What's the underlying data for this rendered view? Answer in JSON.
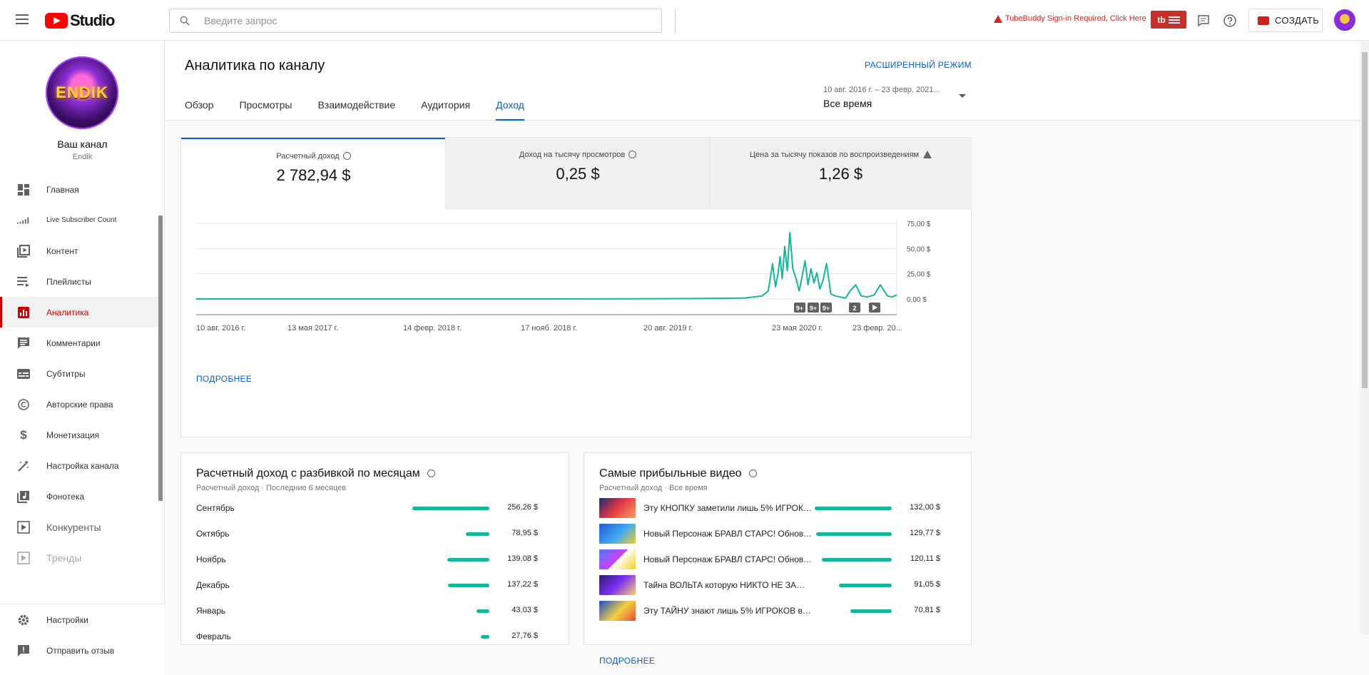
{
  "app": {
    "name": "Studio"
  },
  "search": {
    "placeholder": "Введите запрос"
  },
  "tubebuddy": {
    "warning": "TubeBuddy Sign-in Required, Click Here",
    "badge": "tb"
  },
  "header": {
    "create_label": "СОЗДАТЬ"
  },
  "channel": {
    "label": "Ваш канал",
    "name": "Endik",
    "avatar_text": "ENDIK"
  },
  "sidebar": {
    "items": [
      {
        "label": "Главная",
        "icon": "dashboard-icon"
      },
      {
        "label": "Live Subscriber Count",
        "icon": "signal-bars-icon"
      },
      {
        "label": "Контент",
        "icon": "video-library-icon"
      },
      {
        "label": "Плейлисты",
        "icon": "playlist-icon"
      },
      {
        "label": "Аналитика",
        "icon": "analytics-icon",
        "active": true
      },
      {
        "label": "Комментарии",
        "icon": "comment-icon"
      },
      {
        "label": "Субтитры",
        "icon": "subtitles-icon"
      },
      {
        "label": "Авторские права",
        "icon": "copyright-icon"
      },
      {
        "label": "Монетизация",
        "icon": "dollar-icon"
      },
      {
        "label": "Настройка канала",
        "icon": "magic-wand-icon"
      },
      {
        "label": "Фонотека",
        "icon": "audio-library-icon"
      },
      {
        "label": "Конкуренты",
        "icon": "competitors-icon"
      },
      {
        "label": "Тренды",
        "icon": "trends-icon"
      }
    ],
    "bottom": [
      {
        "label": "Настройки",
        "icon": "gear-icon"
      },
      {
        "label": "Отправить отзыв",
        "icon": "feedback-icon"
      }
    ]
  },
  "page": {
    "title": "Аналитика по каналу",
    "advanced_label": "РАСШИРЕННЫЙ РЕЖИМ",
    "tabs": [
      "Обзор",
      "Просмотры",
      "Взаимодействие",
      "Аудитория",
      "Доход"
    ],
    "active_tab": "Доход",
    "date_range": {
      "dates": "10 авг. 2016 г. – 23 февр. 2021...",
      "label": "Все время"
    }
  },
  "metrics": [
    {
      "label": "Расчетный доход",
      "value": "2 782,94 $",
      "icon": "clock-icon"
    },
    {
      "label": "Доход на тысячу просмотров",
      "value": "0,25 $",
      "icon": "clock-icon"
    },
    {
      "label": "Цена за тысячу показов по воспроизведениям",
      "value": "1,26 $",
      "icon": "warning-icon"
    }
  ],
  "chart_data": {
    "type": "line",
    "x_ticks": [
      "10 авг. 2016 г.",
      "13 мая 2017 г.",
      "14 февр. 2018 г.",
      "17 нояб. 2018 г.",
      "20 авг. 2019 г.",
      "23 мая 2020 г.",
      "23 февр. 20..."
    ],
    "y_ticks": [
      "75,00 $",
      "50,00 $",
      "25,00 $",
      "0,00 $"
    ],
    "ylim": [
      0,
      75
    ],
    "grid": true,
    "color": "#12b79b",
    "series": [
      {
        "x": [
          "2016-08-10",
          "2017-05-13",
          "2018-02-14",
          "2018-11-17",
          "2019-08-20",
          "2019-12-01",
          "2020-03-01",
          "2020-04-10",
          "2020-04-25",
          "2020-05-05",
          "2020-05-12",
          "2020-05-18",
          "2020-05-23",
          "2020-05-28",
          "2020-06-03",
          "2020-06-09",
          "2020-06-15",
          "2020-06-22",
          "2020-06-30",
          "2020-07-07",
          "2020-07-14",
          "2020-07-21",
          "2020-07-28",
          "2020-08-04",
          "2020-08-11",
          "2020-08-18",
          "2020-08-25",
          "2020-09-01",
          "2020-09-10",
          "2020-09-20",
          "2020-10-01",
          "2020-10-12",
          "2020-10-25",
          "2020-11-05",
          "2020-11-18",
          "2020-12-01",
          "2020-12-15",
          "2021-01-01",
          "2021-01-15",
          "2021-02-01",
          "2021-02-12",
          "2021-02-23"
        ],
        "y": [
          0,
          0,
          0,
          0,
          0.3,
          0.5,
          1,
          3,
          8,
          35,
          12,
          25,
          42,
          20,
          52,
          28,
          66,
          30,
          20,
          8,
          22,
          38,
          14,
          30,
          16,
          26,
          10,
          18,
          35,
          5,
          3,
          2,
          1,
          8,
          14,
          3,
          2,
          4,
          14,
          3,
          2,
          4
        ]
      }
    ],
    "markers": [
      "9+",
      "9+",
      "9+",
      "2",
      "play"
    ]
  },
  "chart_more_label": "ПОДРОБНЕЕ",
  "monthly": {
    "title": "Расчетный доход с разбивкой по месяцам",
    "subtitle": "Расчетный доход · Последние 6 месяцев",
    "rows": [
      {
        "label": "Сентябрь",
        "value": "256,26 $",
        "amount": 256.26
      },
      {
        "label": "Октябрь",
        "value": "78,95 $",
        "amount": 78.95
      },
      {
        "label": "Ноябрь",
        "value": "139,08 $",
        "amount": 139.08
      },
      {
        "label": "Декабрь",
        "value": "137,22 $",
        "amount": 137.22
      },
      {
        "label": "Январь",
        "value": "43,03 $",
        "amount": 43.03
      },
      {
        "label": "Февраль",
        "value": "27,76 $",
        "amount": 27.76
      }
    ]
  },
  "top_videos": {
    "title": "Самые прибыльные видео",
    "subtitle": "Расчетный доход · Все время",
    "more_label": "ПОДРОБНЕЕ",
    "rows": [
      {
        "title": "Эту КНОПКУ заметили лишь 5% ИГРОКОВ...",
        "value": "132,00 $",
        "amount": 132.0
      },
      {
        "title": "Новый Персонаж БРАВЛ СТАРС! Обновление...",
        "value": "129,77 $",
        "amount": 129.77
      },
      {
        "title": "Новый Персонаж БРАВЛ СТАРС! Обновление...",
        "value": "120,11 $",
        "amount": 120.11
      },
      {
        "title": "Тайна ВОЛЬТА которую НИКТО НЕ ЗАМЕТИЛ...",
        "value": "91,05 $",
        "amount": 91.05
      },
      {
        "title": "Эту ТАЙНУ знают лишь 5% ИГРОКОВ в Бравл...",
        "value": "70,81 $",
        "amount": 70.81
      }
    ]
  }
}
